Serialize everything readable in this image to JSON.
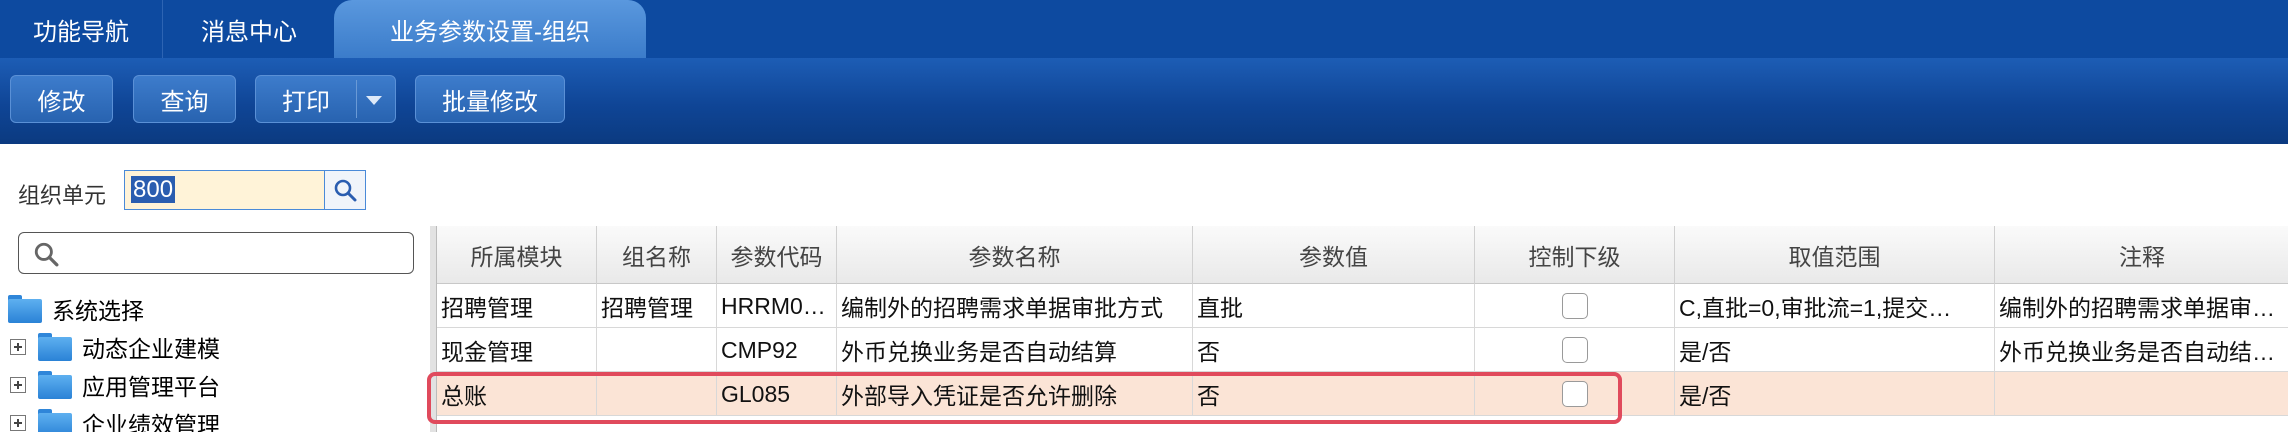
{
  "tabs": [
    {
      "label": "功能导航"
    },
    {
      "label": "消息中心"
    },
    {
      "label": "业务参数设置-组织"
    }
  ],
  "toolbar": {
    "edit_label": "修改",
    "query_label": "查询",
    "print_label": "打印",
    "batch_edit_label": "批量修改"
  },
  "org_filter": {
    "label": "组织单元",
    "value": "800"
  },
  "tree": {
    "search_placeholder": "",
    "root": {
      "label": "系统选择"
    },
    "items": [
      {
        "label": "动态企业建模"
      },
      {
        "label": "应用管理平台"
      },
      {
        "label": "企业绩效管理"
      }
    ]
  },
  "table": {
    "columns": [
      "所属模块",
      "组名称",
      "参数代码",
      "参数名称",
      "参数值",
      "控制下级",
      "取值范围",
      "注释"
    ],
    "rows": [
      {
        "module": "招聘管理",
        "group": "招聘管理",
        "code": "HRRM0…",
        "name": "编制外的招聘需求单据审批方式",
        "value": "直批",
        "control_sub": false,
        "range": "C,直批=0,审批流=1,提交…",
        "note": "编制外的招聘需求单据审…"
      },
      {
        "module": "现金管理",
        "group": "",
        "code": "CMP92",
        "name": "外币兑换业务是否自动结算",
        "value": "否",
        "control_sub": false,
        "range": "是/否",
        "note": "外币兑换业务是否自动结…"
      },
      {
        "module": "总账",
        "group": "",
        "code": "GL085",
        "name": "外部导入凭证是否允许删除",
        "value": "否",
        "control_sub": false,
        "range": "是/否",
        "note": ""
      }
    ],
    "selected_row_index": 2
  },
  "colors": {
    "tabbar": "#0d4aa0",
    "active_tab": "#4a8ad6",
    "toolbar": "#0f4596",
    "selected_row": "#fbe4d6",
    "highlight_border": "#e04a5c",
    "folder": "#3a92e0"
  },
  "icons": [
    "search-icon",
    "chevron-down-icon",
    "folder-icon",
    "expand-plus-icon",
    "checkbox"
  ]
}
